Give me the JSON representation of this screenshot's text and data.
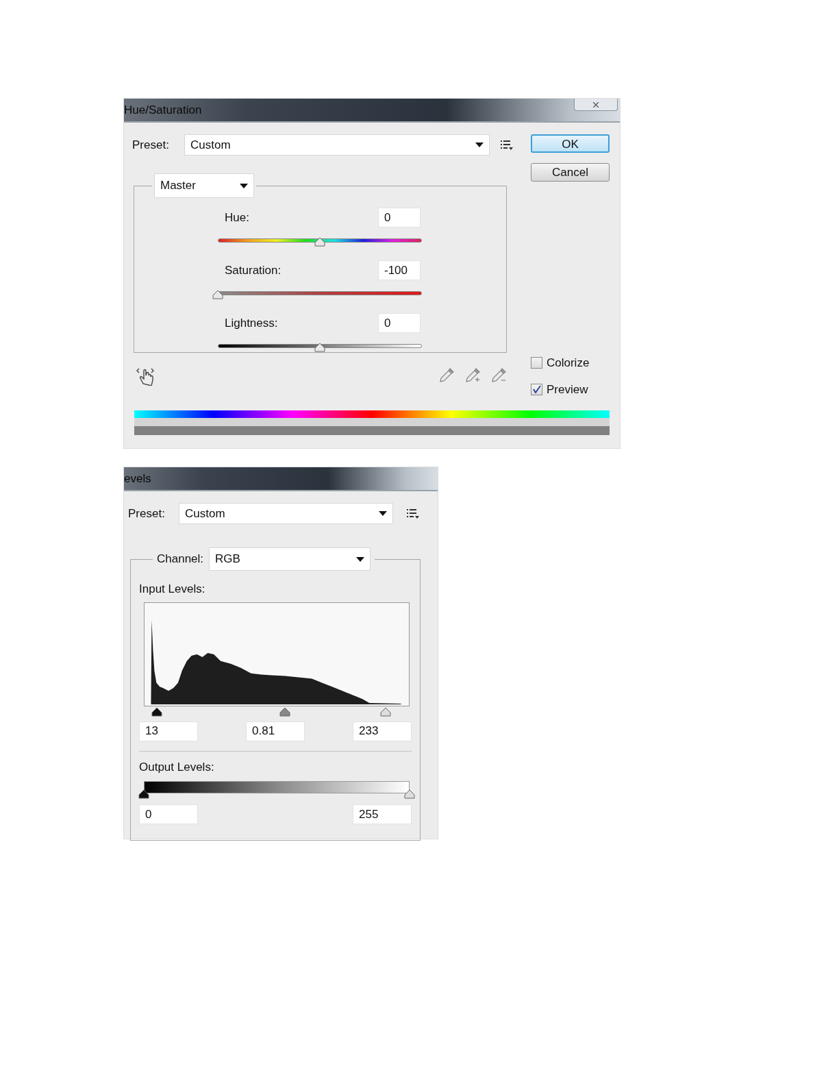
{
  "hue_saturation": {
    "title": "Hue/Saturation",
    "preset": {
      "label": "Preset:",
      "value": "Custom"
    },
    "buttons": [
      {
        "label": "OK",
        "default": true
      },
      {
        "label": "Cancel",
        "default": false
      }
    ],
    "edit": {
      "value": "Master"
    },
    "sliders": [
      {
        "label": "Hue:",
        "value": "0",
        "level": 0.5,
        "kind": "hue"
      },
      {
        "label": "Saturation:",
        "value": "-100",
        "level": 0,
        "kind": "saturation"
      },
      {
        "label": "Lightness:",
        "value": "0",
        "level": 0.5,
        "kind": "lightness"
      }
    ],
    "options": [
      {
        "label": "Colorize",
        "checked": false
      },
      {
        "label": "Preview",
        "checked": true
      }
    ]
  },
  "levels": {
    "title": "evels",
    "preset": {
      "label": "Preset:",
      "value": "Custom"
    },
    "channel": {
      "label": "Channel:",
      "value": "RGB"
    },
    "input": {
      "label": "Input Levels:",
      "sliders": [
        {
          "kind": "shadow",
          "level": 0.05
        },
        {
          "kind": "midtone",
          "level": 0.53
        },
        {
          "kind": "highlight",
          "level": 0.91
        }
      ],
      "values": [
        "13",
        "0.81",
        "233"
      ]
    },
    "output": {
      "label": "Output Levels:",
      "sliders": [
        {
          "kind": "shadow",
          "level": 0
        },
        {
          "kind": "highlight",
          "level": 1
        }
      ],
      "values": [
        "0",
        "255"
      ]
    }
  }
}
